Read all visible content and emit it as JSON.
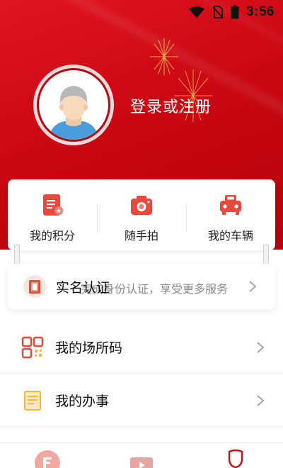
{
  "status_bar": {
    "time": "3:56",
    "icons": [
      "wifi-icon",
      "no-sim-icon",
      "battery-icon"
    ]
  },
  "profile": {
    "login_label": "登录或注册",
    "avatar": "default-avatar"
  },
  "quick_actions": [
    {
      "label": "我的积分",
      "icon": "points-icon"
    },
    {
      "label": "随手拍",
      "icon": "camera-icon"
    },
    {
      "label": "我的车辆",
      "icon": "car-icon"
    }
  ],
  "real_name": {
    "title": "实名认证",
    "description": "完成身份认证，享受更多服务",
    "icon": "id-card-icon"
  },
  "menu": [
    {
      "label": "我的场所码",
      "icon": "qr-code-icon"
    },
    {
      "label": "我的办事",
      "icon": "document-icon"
    }
  ],
  "tabbar": {
    "tabs": [
      "home-tab",
      "video-tab",
      "profile-tab"
    ]
  },
  "colors": {
    "brand_red": "#d20d18",
    "icon_red": "#e8493c",
    "menu_icon_gold": "#f0b94a"
  }
}
